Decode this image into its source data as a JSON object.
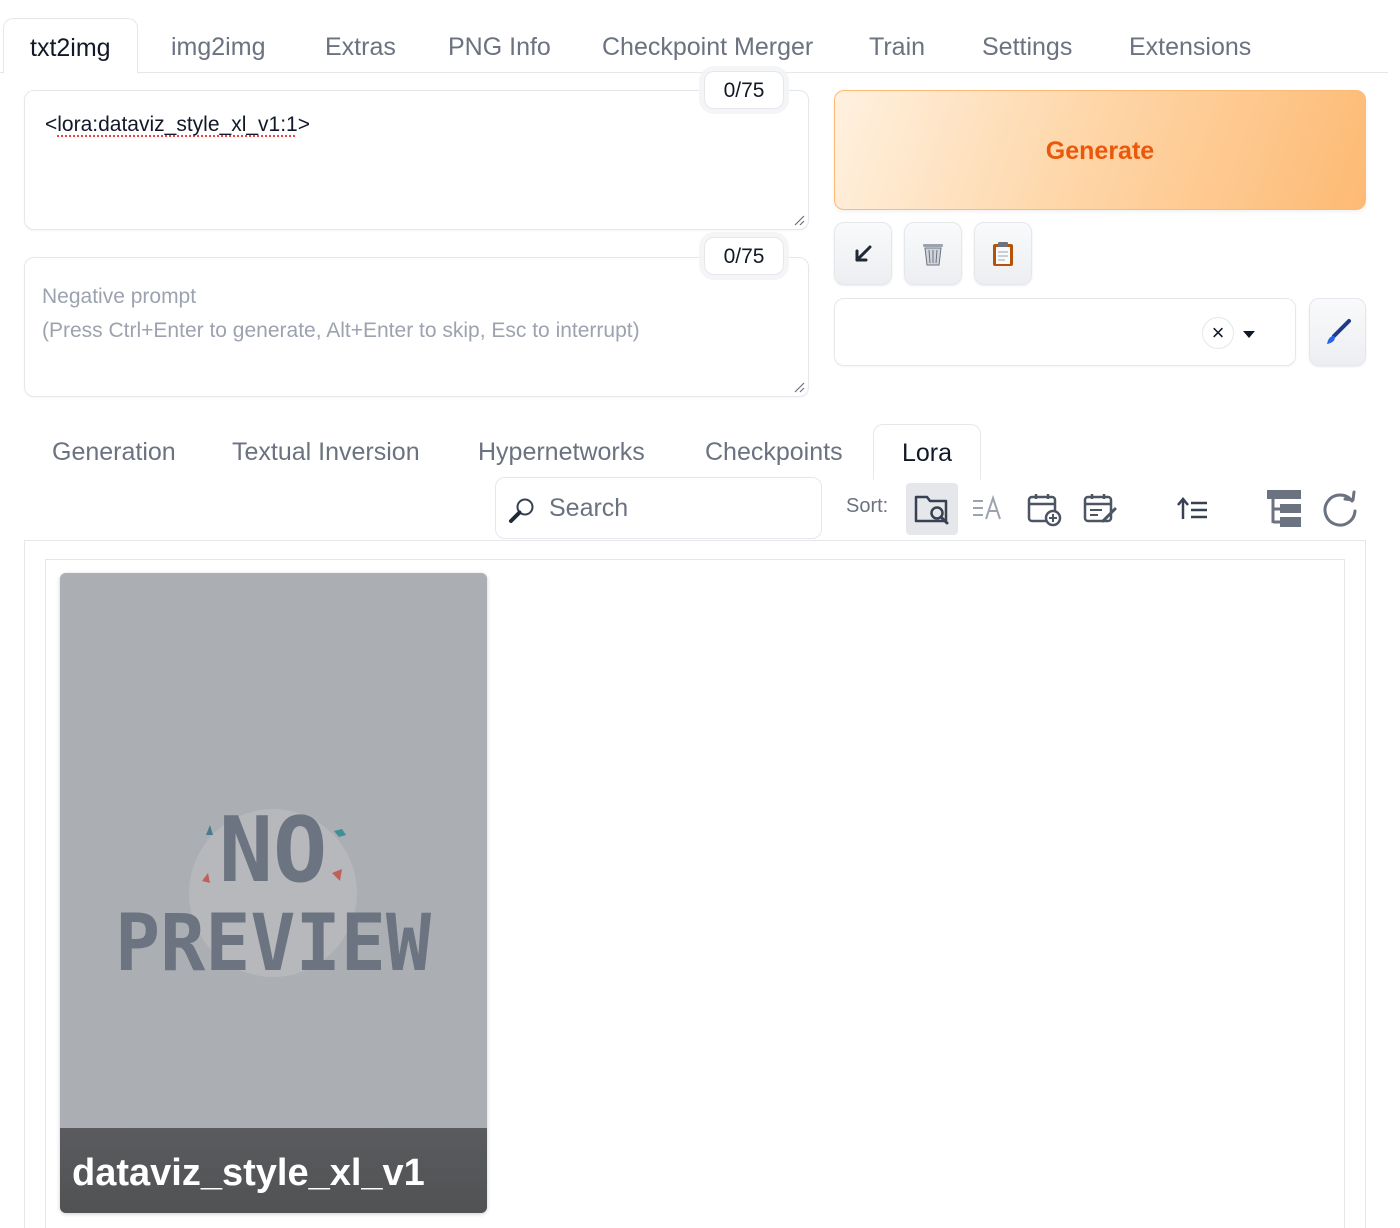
{
  "top_tabs": [
    {
      "label": "txt2img",
      "active": true
    },
    {
      "label": "img2img"
    },
    {
      "label": "Extras"
    },
    {
      "label": "PNG Info"
    },
    {
      "label": "Checkpoint Merger"
    },
    {
      "label": "Train"
    },
    {
      "label": "Settings"
    },
    {
      "label": "Extensions"
    }
  ],
  "prompt": {
    "value_prefix": "<",
    "value_main": "lora:dataviz_style_xl_v1:1",
    "value_suffix": ">",
    "token_count": "0/75"
  },
  "negative_prompt": {
    "placeholder": "Negative prompt\n(Press Ctrl+Enter to generate, Alt+Enter to skip, Esc to interrupt)",
    "token_count": "0/75"
  },
  "generate": {
    "label": "Generate"
  },
  "tool_buttons": [
    {
      "icon": "arrow-down-left-icon"
    },
    {
      "icon": "trash-icon"
    },
    {
      "icon": "clipboard-icon"
    }
  ],
  "styles_dropdown": {
    "value": "",
    "clear_symbol": "×"
  },
  "sub_tabs": [
    {
      "label": "Generation"
    },
    {
      "label": "Textual Inversion"
    },
    {
      "label": "Hypernetworks"
    },
    {
      "label": "Checkpoints"
    },
    {
      "label": "Lora",
      "active": true
    }
  ],
  "search": {
    "placeholder": "Search"
  },
  "sort": {
    "label": "Sort:",
    "selected": "path"
  },
  "cards": [
    {
      "name": "dataviz_style_xl_v1",
      "preview_line1": "NO",
      "preview_line2": "PREVIEW"
    }
  ],
  "colors": {
    "generate_text": "#ea580c",
    "generate_bg": "#fdba74",
    "border": "#e5e7eb",
    "card_bg": "#abaeb2"
  }
}
